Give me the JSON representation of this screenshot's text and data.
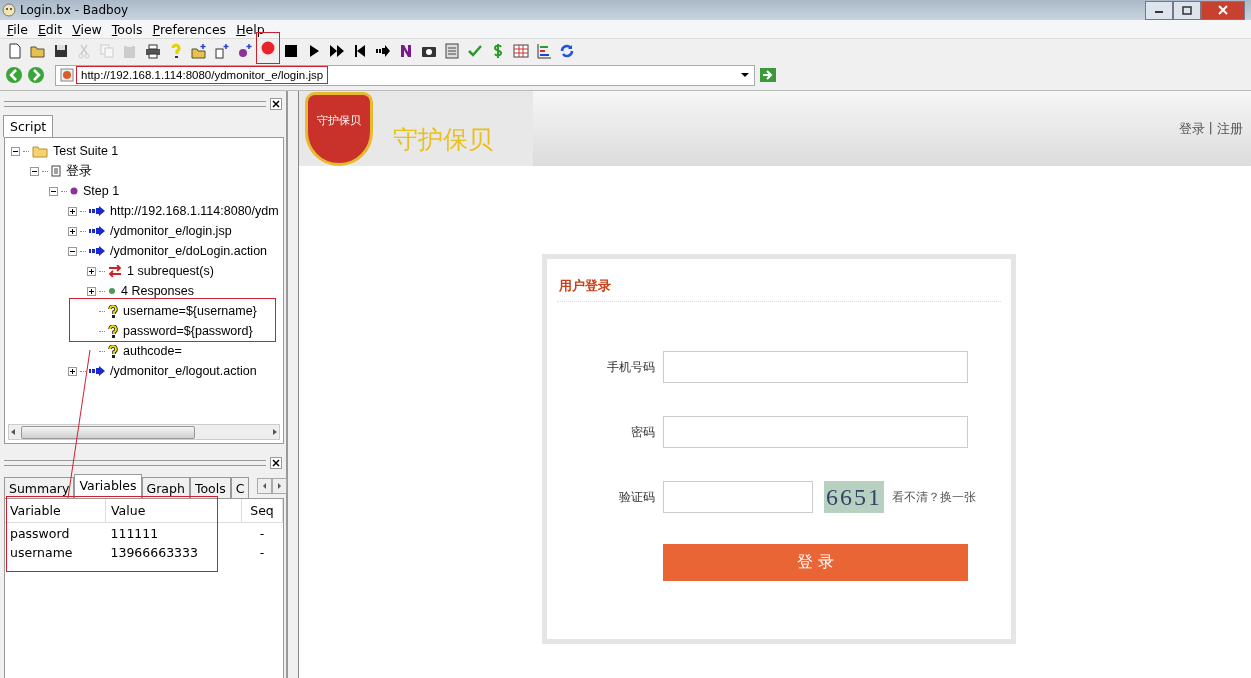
{
  "window": {
    "title": "Login.bx - Badboy"
  },
  "menu": [
    "File",
    "Edit",
    "View",
    "Tools",
    "Preferences",
    "Help"
  ],
  "toolbar": [
    {
      "kind": "new",
      "disabled": false
    },
    {
      "kind": "open",
      "disabled": false
    },
    {
      "kind": "save",
      "disabled": false
    },
    {
      "kind": "cut",
      "disabled": true
    },
    {
      "kind": "copy",
      "disabled": true
    },
    {
      "kind": "paste",
      "disabled": true
    },
    {
      "kind": "print",
      "disabled": false
    },
    {
      "kind": "help",
      "disabled": false
    },
    {
      "kind": "add-suite",
      "disabled": false
    },
    {
      "kind": "add-test",
      "disabled": false
    },
    {
      "kind": "add-step",
      "disabled": false
    },
    {
      "kind": "record",
      "disabled": false
    },
    {
      "kind": "stop",
      "disabled": false
    },
    {
      "kind": "play",
      "disabled": false
    },
    {
      "kind": "play-all",
      "disabled": false
    },
    {
      "kind": "rewind",
      "disabled": false
    },
    {
      "kind": "jump",
      "disabled": false
    },
    {
      "kind": "n",
      "disabled": false
    },
    {
      "kind": "camera",
      "disabled": false
    },
    {
      "kind": "doc",
      "disabled": false
    },
    {
      "kind": "check",
      "disabled": false
    },
    {
      "kind": "dollar",
      "disabled": false
    },
    {
      "kind": "table",
      "disabled": false
    },
    {
      "kind": "chart",
      "disabled": false
    },
    {
      "kind": "refresh",
      "disabled": false
    }
  ],
  "address": {
    "value": "http://192.168.1.114:8080/ydmonitor_e/login.jsp"
  },
  "script_tab": {
    "label": "Script",
    "selected": true
  },
  "tree": [
    {
      "label": "Test Suite 1",
      "kind": "suite",
      "expanded": true,
      "children": [
        {
          "label": "登录",
          "kind": "test",
          "expanded": true,
          "children": [
            {
              "label": "Step 1",
              "kind": "step",
              "expanded": true,
              "children": [
                {
                  "label": "http://192.168.1.114:8080/ydm",
                  "kind": "request",
                  "expanded": false
                },
                {
                  "label": "/ydmonitor_e/login.jsp",
                  "kind": "request",
                  "expanded": false
                },
                {
                  "label": "/ydmonitor_e/doLogin.action",
                  "kind": "request",
                  "expanded": true,
                  "children": [
                    {
                      "label": "1 subrequest(s)",
                      "kind": "subrequest",
                      "expanded": false
                    },
                    {
                      "label": "4 Responses",
                      "kind": "response",
                      "expanded": false
                    },
                    {
                      "label": "username=${username}",
                      "kind": "param"
                    },
                    {
                      "label": "password=${password}",
                      "kind": "param"
                    },
                    {
                      "label": "authcode=",
                      "kind": "param"
                    }
                  ]
                },
                {
                  "label": "/ydmonitor_e/logout.action",
                  "kind": "request",
                  "expanded": false
                }
              ]
            }
          ]
        }
      ]
    }
  ],
  "bottom_tabs": [
    {
      "label": "Summary",
      "selected": false
    },
    {
      "label": "Variables",
      "selected": true
    },
    {
      "label": "Graph",
      "selected": false
    },
    {
      "label": "Tools",
      "selected": false
    },
    {
      "label": "C",
      "selected": false
    }
  ],
  "variables": {
    "columns": [
      "Variable",
      "Value",
      "Seq"
    ],
    "rows": [
      [
        "password",
        "111111",
        "-"
      ],
      [
        "username",
        "13966663333",
        "-"
      ]
    ]
  },
  "site": {
    "logo_text": "守护保贝",
    "brand": "守护保贝",
    "links": [
      "登录",
      "注册"
    ],
    "separator": "|"
  },
  "login": {
    "title": "用户登录",
    "fields": [
      {
        "label": "手机号码",
        "kind": "wide"
      },
      {
        "label": "密码",
        "kind": "wide"
      },
      {
        "label": "验证码",
        "kind": "captcha"
      }
    ],
    "captcha": "6651",
    "refresh": "看不清？换一张",
    "submit": "登 录"
  }
}
